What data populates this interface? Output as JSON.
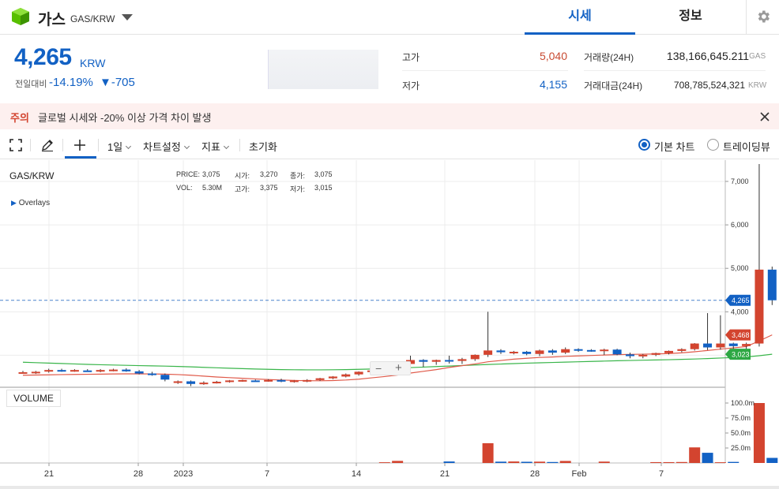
{
  "header": {
    "coin_name": "가스",
    "pair": "GAS/KRW",
    "tabs": [
      {
        "label": "시세"
      },
      {
        "label": "정보"
      }
    ]
  },
  "summary": {
    "price": "4,265",
    "price_unit": "KRW",
    "change_label": "전일대비",
    "change_pct": "-14.19%",
    "change_abs": "▼-705",
    "high_label": "고가",
    "high_value": "5,040",
    "low_label": "저가",
    "low_value": "4,155",
    "volume_label": "거래량(24H)",
    "volume_value": "138,166,645.211",
    "volume_unit": "GAS",
    "amount_label": "거래대금(24H)",
    "amount_value": "708,785,524,321",
    "amount_unit": "KRW"
  },
  "warning": {
    "tag": "주의",
    "text": "글로벌 시세와 -20% 이상 가격 차이 발생"
  },
  "toolbar": {
    "interval": "1일",
    "chart_settings": "차트설정",
    "indicators": "지표",
    "reset": "초기화",
    "basic_chart": "기본 차트",
    "tradingview": "트레이딩뷰"
  },
  "chart_info": {
    "symbol": "GAS/KRW",
    "overlays": "Overlays",
    "price_label": "PRICE:",
    "price_val": "3,075",
    "open_label": "시가:",
    "open_val": "3,270",
    "close_label": "종가:",
    "close_val": "3,075",
    "vol_label": "VOL:",
    "vol_val": "5.30M",
    "high_label": "고가:",
    "high_val": "3,375",
    "low_label": "저가:",
    "low_val": "3,015",
    "volume_panel": "VOLUME"
  },
  "chart_data": {
    "type": "candlestick",
    "price_axis_ticks": [
      "7,000",
      "6,000",
      "5,000",
      "4,000"
    ],
    "volume_axis_ticks": [
      "100.0m",
      "75.0m",
      "50.0m",
      "25.0m"
    ],
    "x_tick_labels": [
      "21",
      "28",
      "2023",
      "7",
      "14",
      "21",
      "28",
      "Feb",
      "7"
    ],
    "price_tags": [
      {
        "label": "4,265",
        "value": 4265,
        "color": "#1261c4"
      },
      {
        "label": "3,468",
        "value": 3468,
        "color": "#d3442f"
      },
      {
        "label": "3,023",
        "value": 3023,
        "color": "#2ea844"
      }
    ],
    "candles": [
      {
        "o": 2610,
        "h": 2640,
        "l": 2580,
        "c": 2610
      },
      {
        "o": 2600,
        "h": 2640,
        "l": 2570,
        "c": 2620
      },
      {
        "o": 2640,
        "h": 2690,
        "l": 2600,
        "c": 2660
      },
      {
        "o": 2660,
        "h": 2690,
        "l": 2620,
        "c": 2640
      },
      {
        "o": 2650,
        "h": 2680,
        "l": 2620,
        "c": 2660
      },
      {
        "o": 2650,
        "h": 2680,
        "l": 2620,
        "c": 2630
      },
      {
        "o": 2640,
        "h": 2680,
        "l": 2610,
        "c": 2660
      },
      {
        "o": 2660,
        "h": 2690,
        "l": 2630,
        "c": 2670
      },
      {
        "o": 2670,
        "h": 2700,
        "l": 2620,
        "c": 2630
      },
      {
        "o": 2630,
        "h": 2660,
        "l": 2560,
        "c": 2580
      },
      {
        "o": 2580,
        "h": 2620,
        "l": 2530,
        "c": 2550
      },
      {
        "o": 2550,
        "h": 2580,
        "l": 2400,
        "c": 2440
      },
      {
        "o": 2390,
        "h": 2420,
        "l": 2340,
        "c": 2400
      },
      {
        "o": 2400,
        "h": 2420,
        "l": 2290,
        "c": 2340
      },
      {
        "o": 2340,
        "h": 2400,
        "l": 2320,
        "c": 2370
      },
      {
        "o": 2370,
        "h": 2410,
        "l": 2350,
        "c": 2390
      },
      {
        "o": 2390,
        "h": 2430,
        "l": 2370,
        "c": 2420
      },
      {
        "o": 2410,
        "h": 2440,
        "l": 2390,
        "c": 2430
      },
      {
        "o": 2420,
        "h": 2440,
        "l": 2400,
        "c": 2410
      },
      {
        "o": 2410,
        "h": 2450,
        "l": 2390,
        "c": 2430
      },
      {
        "o": 2430,
        "h": 2460,
        "l": 2380,
        "c": 2400
      },
      {
        "o": 2400,
        "h": 2430,
        "l": 2370,
        "c": 2420
      },
      {
        "o": 2410,
        "h": 2450,
        "l": 2380,
        "c": 2430
      },
      {
        "o": 2430,
        "h": 2480,
        "l": 2410,
        "c": 2470
      },
      {
        "o": 2470,
        "h": 2520,
        "l": 2450,
        "c": 2510
      },
      {
        "o": 2510,
        "h": 2580,
        "l": 2490,
        "c": 2560
      },
      {
        "o": 2560,
        "h": 2630,
        "l": 2530,
        "c": 2620
      },
      {
        "o": 2620,
        "h": 2690,
        "l": 2590,
        "c": 2650
      },
      {
        "o": 2650,
        "h": 2720,
        "l": 2620,
        "c": 2700
      },
      {
        "o": 2700,
        "h": 2840,
        "l": 2680,
        "c": 2800
      },
      {
        "o": 2800,
        "h": 2990,
        "l": 2740,
        "c": 2890
      },
      {
        "o": 2890,
        "h": 2910,
        "l": 2730,
        "c": 2850
      },
      {
        "o": 2850,
        "h": 2900,
        "l": 2780,
        "c": 2890
      },
      {
        "o": 2890,
        "h": 2990,
        "l": 2810,
        "c": 2870
      },
      {
        "o": 2870,
        "h": 2940,
        "l": 2800,
        "c": 2910
      },
      {
        "o": 2910,
        "h": 3020,
        "l": 2870,
        "c": 3010
      },
      {
        "o": 3010,
        "h": 4000,
        "l": 2960,
        "c": 3110
      },
      {
        "o": 3110,
        "h": 3140,
        "l": 3030,
        "c": 3070
      },
      {
        "o": 3060,
        "h": 3100,
        "l": 3020,
        "c": 3080
      },
      {
        "o": 3080,
        "h": 3100,
        "l": 3000,
        "c": 3030
      },
      {
        "o": 3030,
        "h": 3130,
        "l": 2980,
        "c": 3110
      },
      {
        "o": 3110,
        "h": 3140,
        "l": 3010,
        "c": 3060
      },
      {
        "o": 3060,
        "h": 3180,
        "l": 3030,
        "c": 3140
      },
      {
        "o": 3140,
        "h": 3160,
        "l": 3080,
        "c": 3120
      },
      {
        "o": 3120,
        "h": 3140,
        "l": 3080,
        "c": 3100
      },
      {
        "o": 3100,
        "h": 3150,
        "l": 3010,
        "c": 3130
      },
      {
        "o": 3130,
        "h": 3150,
        "l": 3000,
        "c": 3020
      },
      {
        "o": 3020,
        "h": 3060,
        "l": 2930,
        "c": 2980
      },
      {
        "o": 2980,
        "h": 3030,
        "l": 2930,
        "c": 3010
      },
      {
        "o": 3010,
        "h": 3060,
        "l": 2980,
        "c": 3050
      },
      {
        "o": 3050,
        "h": 3110,
        "l": 3020,
        "c": 3100
      },
      {
        "o": 3100,
        "h": 3160,
        "l": 3070,
        "c": 3140
      },
      {
        "o": 3140,
        "h": 3280,
        "l": 3110,
        "c": 3270
      },
      {
        "o": 3270,
        "h": 3970,
        "l": 3120,
        "c": 3180
      },
      {
        "o": 3180,
        "h": 3920,
        "l": 3130,
        "c": 3270
      },
      {
        "o": 3270,
        "h": 3290,
        "l": 3120,
        "c": 3210
      },
      {
        "o": 3210,
        "h": 3290,
        "l": 3110,
        "c": 3260
      },
      {
        "o": 3270,
        "h": 7400,
        "l": 3200,
        "c": 4970
      },
      {
        "o": 4970,
        "h": 5040,
        "l": 4155,
        "c": 4265
      }
    ],
    "volume": [
      0,
      0,
      0,
      0,
      0,
      0,
      0,
      0,
      0,
      0,
      0,
      0,
      0,
      0,
      0,
      0,
      0,
      0,
      0,
      0,
      0,
      0,
      0,
      0,
      0,
      0,
      0,
      0,
      1.2,
      3.5,
      0,
      0,
      0,
      2.5,
      0,
      0,
      33,
      2.2,
      2.5,
      2.0,
      2.2,
      1.6,
      3.4,
      0,
      0,
      2.3,
      0,
      0,
      0,
      1.4,
      1.4,
      1.6,
      26,
      17,
      1.2,
      1.8,
      0,
      100,
      8.5
    ],
    "ma_red": [
      2540,
      2545,
      2550,
      2555,
      2558,
      2562,
      2566,
      2570,
      2572,
      2572,
      2570,
      2565,
      2555,
      2540,
      2520,
      2500,
      2485,
      2470,
      2455,
      2440,
      2430,
      2420,
      2415,
      2412,
      2418,
      2430,
      2450,
      2480,
      2510,
      2545,
      2590,
      2630,
      2670,
      2720,
      2760,
      2800,
      2850,
      2880,
      2910,
      2930,
      2950,
      2960,
      2975,
      2985,
      2995,
      3005,
      3015,
      3020,
      3025,
      3030,
      3040,
      3055,
      3080,
      3110,
      3140,
      3170,
      3200,
      3330,
      3468
    ],
    "ma_green": [
      2840,
      2830,
      2820,
      2810,
      2800,
      2790,
      2782,
      2775,
      2768,
      2762,
      2756,
      2750,
      2742,
      2733,
      2722,
      2712,
      2702,
      2692,
      2683,
      2676,
      2670,
      2666,
      2664,
      2664,
      2666,
      2670,
      2676,
      2684,
      2694,
      2704,
      2716,
      2728,
      2740,
      2752,
      2764,
      2776,
      2788,
      2798,
      2808,
      2818,
      2826,
      2834,
      2842,
      2850,
      2858,
      2866,
      2874,
      2880,
      2886,
      2892,
      2898,
      2906,
      2914,
      2924,
      2936,
      2948,
      2962,
      2990,
      3023
    ]
  }
}
